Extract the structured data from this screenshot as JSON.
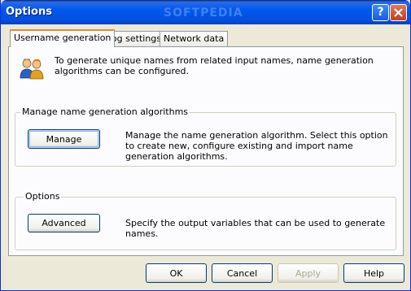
{
  "window": {
    "title": "Options",
    "help_glyph": "?",
    "watermark": "SOFTPEDIA"
  },
  "tabs": [
    {
      "label": "Username generation",
      "active": true
    },
    {
      "label": "Log settings",
      "active": false
    },
    {
      "label": "Network data",
      "active": false
    }
  ],
  "intro": {
    "icon": "users-icon",
    "text": "To generate unique names from related input names, name generation algorithms can be configured."
  },
  "manage_group": {
    "legend": "Manage name generation algorithms",
    "button_label": "Manage",
    "description": "Manage the name generation algorithm. Select this option to create new, configure existing and import name generation algorithms."
  },
  "options_group": {
    "legend": "Options",
    "button_label": "Advanced",
    "description": "Specify the output variables that can be used to generate names."
  },
  "footer": {
    "ok": "OK",
    "cancel": "Cancel",
    "apply": "Apply",
    "help": "Help"
  }
}
